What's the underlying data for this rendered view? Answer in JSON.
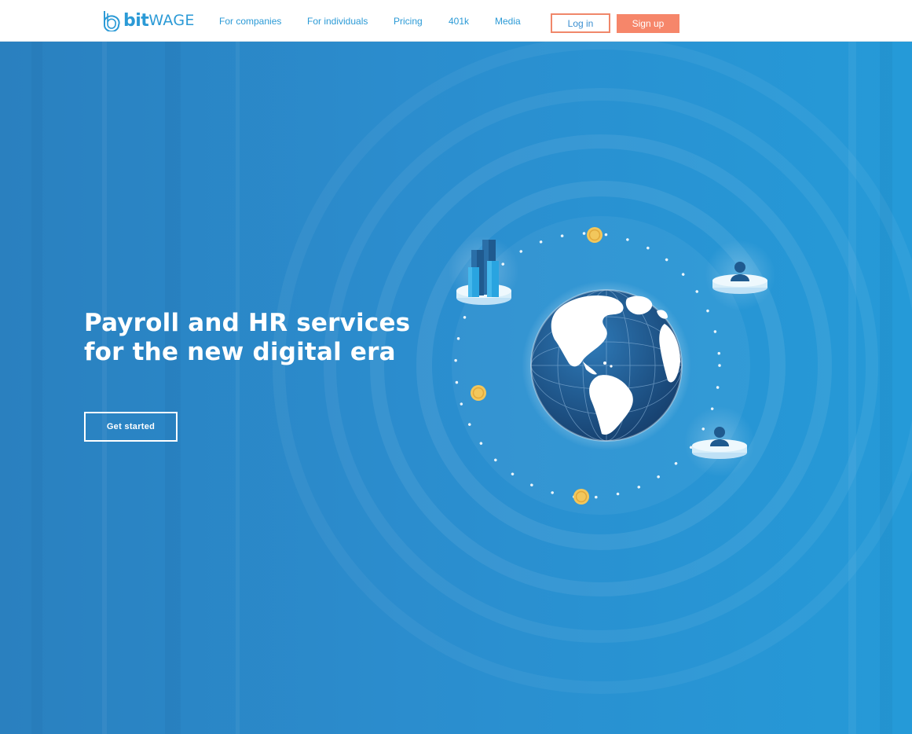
{
  "brand": {
    "bit": "bit",
    "wage": "WAGE",
    "logo_icon": "bitwage-leaf-icon"
  },
  "nav": {
    "links": [
      "For companies",
      "For individuals",
      "Pricing",
      "401k",
      "Media"
    ],
    "login_label": "Log in",
    "signup_label": "Sign up"
  },
  "hero": {
    "headline_line1": "Payroll and HR services",
    "headline_line2": "for the new digital era",
    "cta_label": "Get started",
    "illustration": {
      "icons": [
        "globe-icon",
        "buildings-icon",
        "person-icon",
        "person-icon",
        "coin-icon",
        "coin-icon",
        "coin-icon"
      ]
    }
  },
  "colors": {
    "accent": "#2b9ad6",
    "button_orange": "#f6866a",
    "hero_blue": "#2b8dce",
    "globe_navy": "#1f5a8f",
    "coin_gold": "#f2c75c"
  }
}
